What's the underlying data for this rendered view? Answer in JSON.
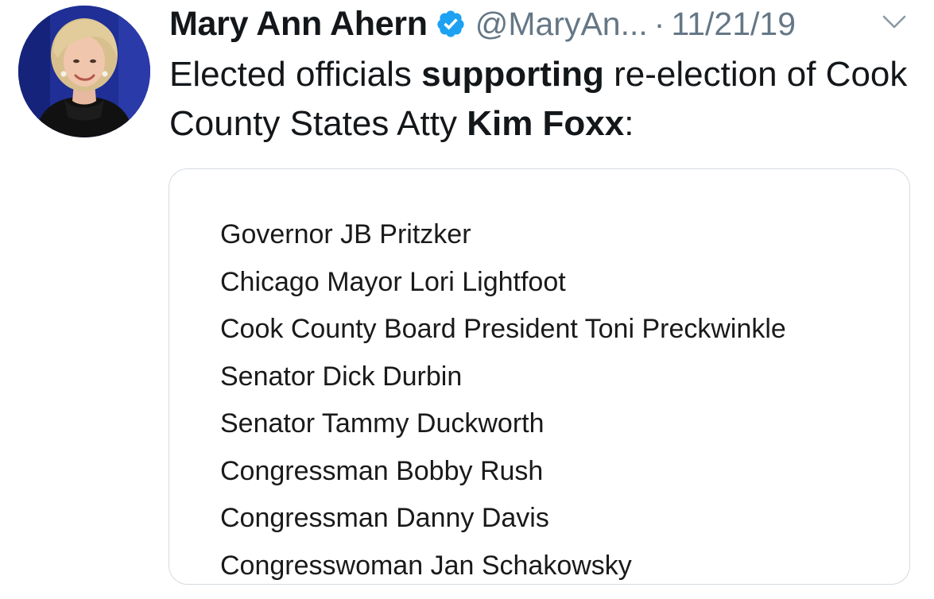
{
  "tweet": {
    "author_name": "Mary Ann Ahern",
    "handle": "@MaryAn...",
    "separator": "·",
    "date": "11/21/19",
    "text_part1": "Elected officials ",
    "text_bold1": "supporting",
    "text_part2": " re-election of Cook County States Atty ",
    "text_bold2": "Kim Foxx",
    "text_part3": ":",
    "icons": {
      "verified": "verified-badge-icon",
      "caret": "chevron-down-icon",
      "avatar": "profile-photo"
    },
    "colors": {
      "verified_blue": "#1da1f2",
      "secondary_text": "#657786",
      "card_border": "#d4dbe1"
    }
  },
  "card": {
    "items": [
      "Governor JB Pritzker",
      "Chicago Mayor Lori Lightfoot",
      "Cook County Board President Toni Preckwinkle",
      "Senator Dick Durbin",
      "Senator Tammy Duckworth",
      "Congressman Bobby Rush",
      "Congressman Danny Davis",
      "Congresswoman Jan Schakowsky"
    ]
  }
}
